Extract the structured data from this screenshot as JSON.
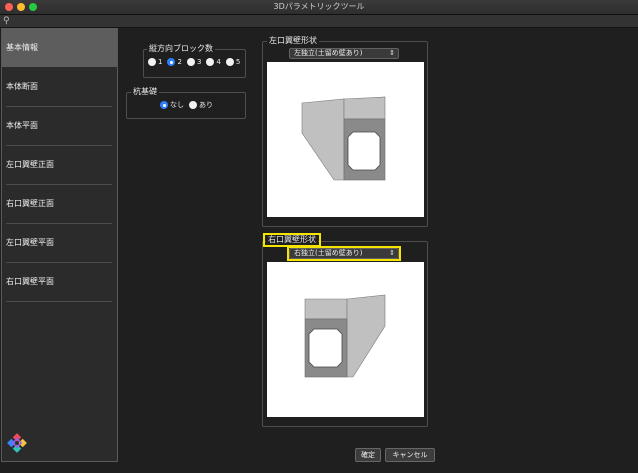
{
  "window": {
    "title": "3Dパラメトリックツール"
  },
  "toolbar": {
    "pin_icon": "pin-icon"
  },
  "sidebar": {
    "items": [
      {
        "label": "基本情報",
        "selected": true
      },
      {
        "label": "本体断面",
        "selected": false
      },
      {
        "label": "本体平面",
        "selected": false
      },
      {
        "label": "左口翼壁正面",
        "selected": false
      },
      {
        "label": "右口翼壁正面",
        "selected": false
      },
      {
        "label": "左口翼壁平面",
        "selected": false
      },
      {
        "label": "右口翼壁平面",
        "selected": false
      }
    ]
  },
  "blocks": {
    "title": "縦方向ブロック数",
    "options": [
      "1",
      "2",
      "3",
      "4",
      "5"
    ],
    "selected": "2"
  },
  "pile": {
    "title": "杭基礎",
    "options": [
      "なし",
      "あり"
    ],
    "selected": "なし"
  },
  "left_wing": {
    "title": "左口翼壁形状",
    "select_value": "左独立(土留め壁あり)"
  },
  "right_wing": {
    "title": "右口翼壁形状",
    "select_value": "右独立(土留め壁あり)"
  },
  "buttons": {
    "ok": "確定",
    "cancel": "キャンセル"
  },
  "colors": {
    "highlight": "#f5e400",
    "selected_radio": "#2d7ff9",
    "wing_wall": "#c0c0c0",
    "box_body": "#8a8a8a"
  }
}
